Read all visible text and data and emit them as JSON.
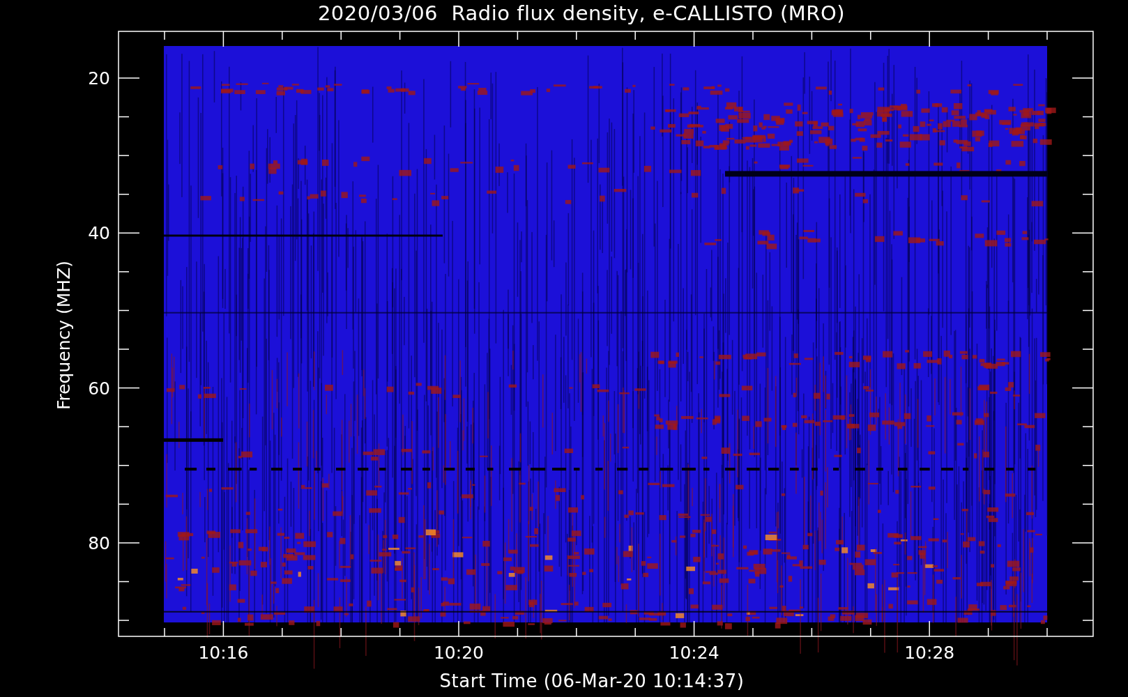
{
  "title": "2020/03/06  Radio flux density, e-CALLISTO (MRO)",
  "plot": {
    "ylabel": "Frequency (MHZ)",
    "xlabel": "Start Time (06-Mar-20 10:14:37)",
    "yticks": [
      "20",
      "40",
      "60",
      "80"
    ],
    "xticks": [
      "10:16",
      "10:20",
      "10:24",
      "10:28"
    ]
  }
}
